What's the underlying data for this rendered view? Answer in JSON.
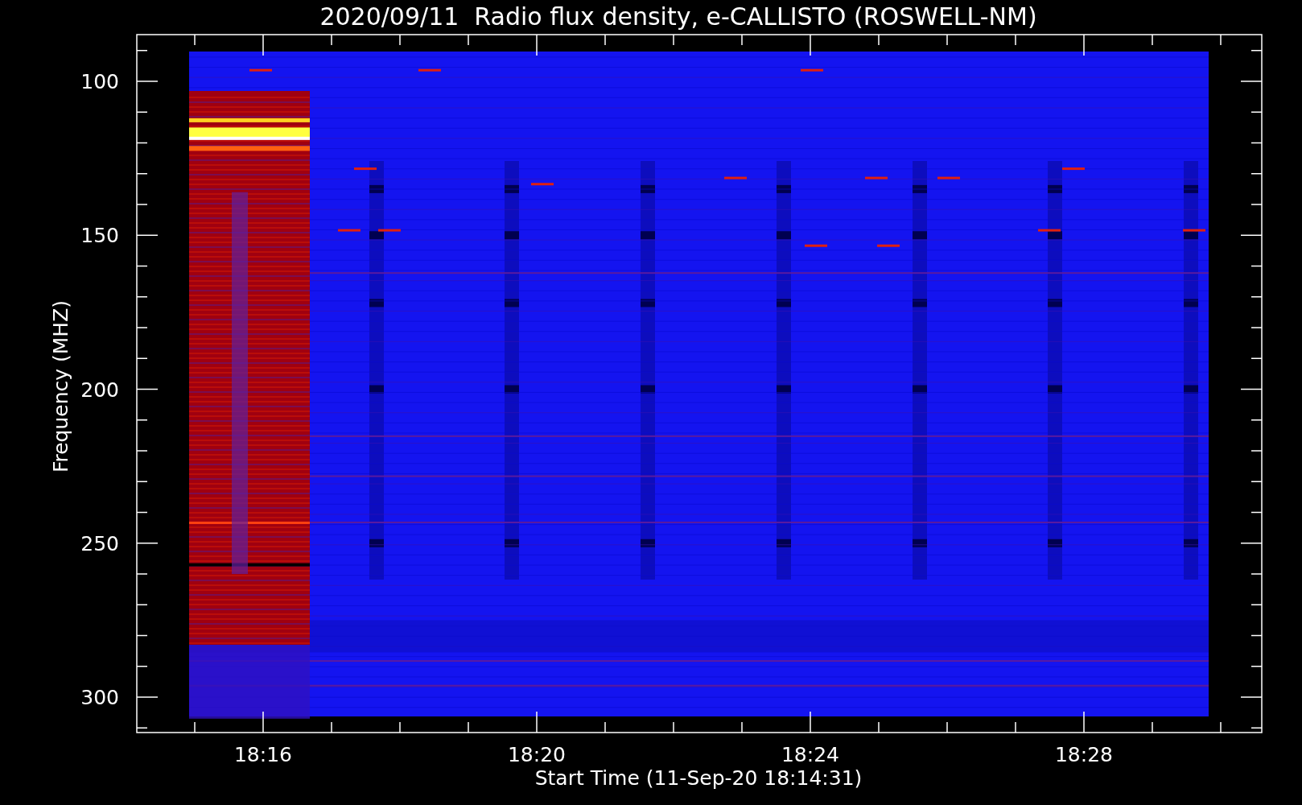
{
  "title": "2020/09/11  Radio flux density, e-CALLISTO (ROSWELL-NM)",
  "y_axis": {
    "label": "Frequency (MHZ)",
    "ticks": [
      "100",
      "150",
      "200",
      "250",
      "300"
    ]
  },
  "x_axis": {
    "label": "Start Time (11-Sep-20 18:14:31)",
    "ticks": [
      "18:16",
      "18:20",
      "18:24",
      "18:28"
    ]
  }
}
